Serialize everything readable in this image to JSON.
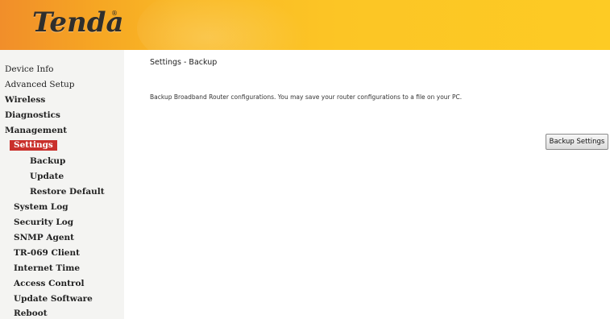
{
  "header": {
    "brand": "Tenda",
    "registered_mark": "®",
    "accent_color": "#fcc525",
    "gradient_start_color": "#f18e2a"
  },
  "sidebar": {
    "items": [
      {
        "label": "Device Info"
      },
      {
        "label": "Advanced Setup"
      },
      {
        "label": "Wireless"
      },
      {
        "label": "Diagnostics"
      },
      {
        "label": "Management"
      },
      {
        "label": "Settings"
      },
      {
        "label": "Backup"
      },
      {
        "label": "Update"
      },
      {
        "label": "Restore Default"
      },
      {
        "label": "System Log"
      },
      {
        "label": "Security Log"
      },
      {
        "label": "SNMP Agent"
      },
      {
        "label": "TR-069 Client"
      },
      {
        "label": "Internet Time"
      },
      {
        "label": "Access Control"
      },
      {
        "label": "Update Software"
      },
      {
        "label": "Reboot"
      }
    ],
    "active_color": "#c9302c"
  },
  "main": {
    "title": "Settings - Backup",
    "description": "Backup Broadband Router configurations. You may save your router configurations to a file on your PC.",
    "button_label": "Backup Settings"
  }
}
